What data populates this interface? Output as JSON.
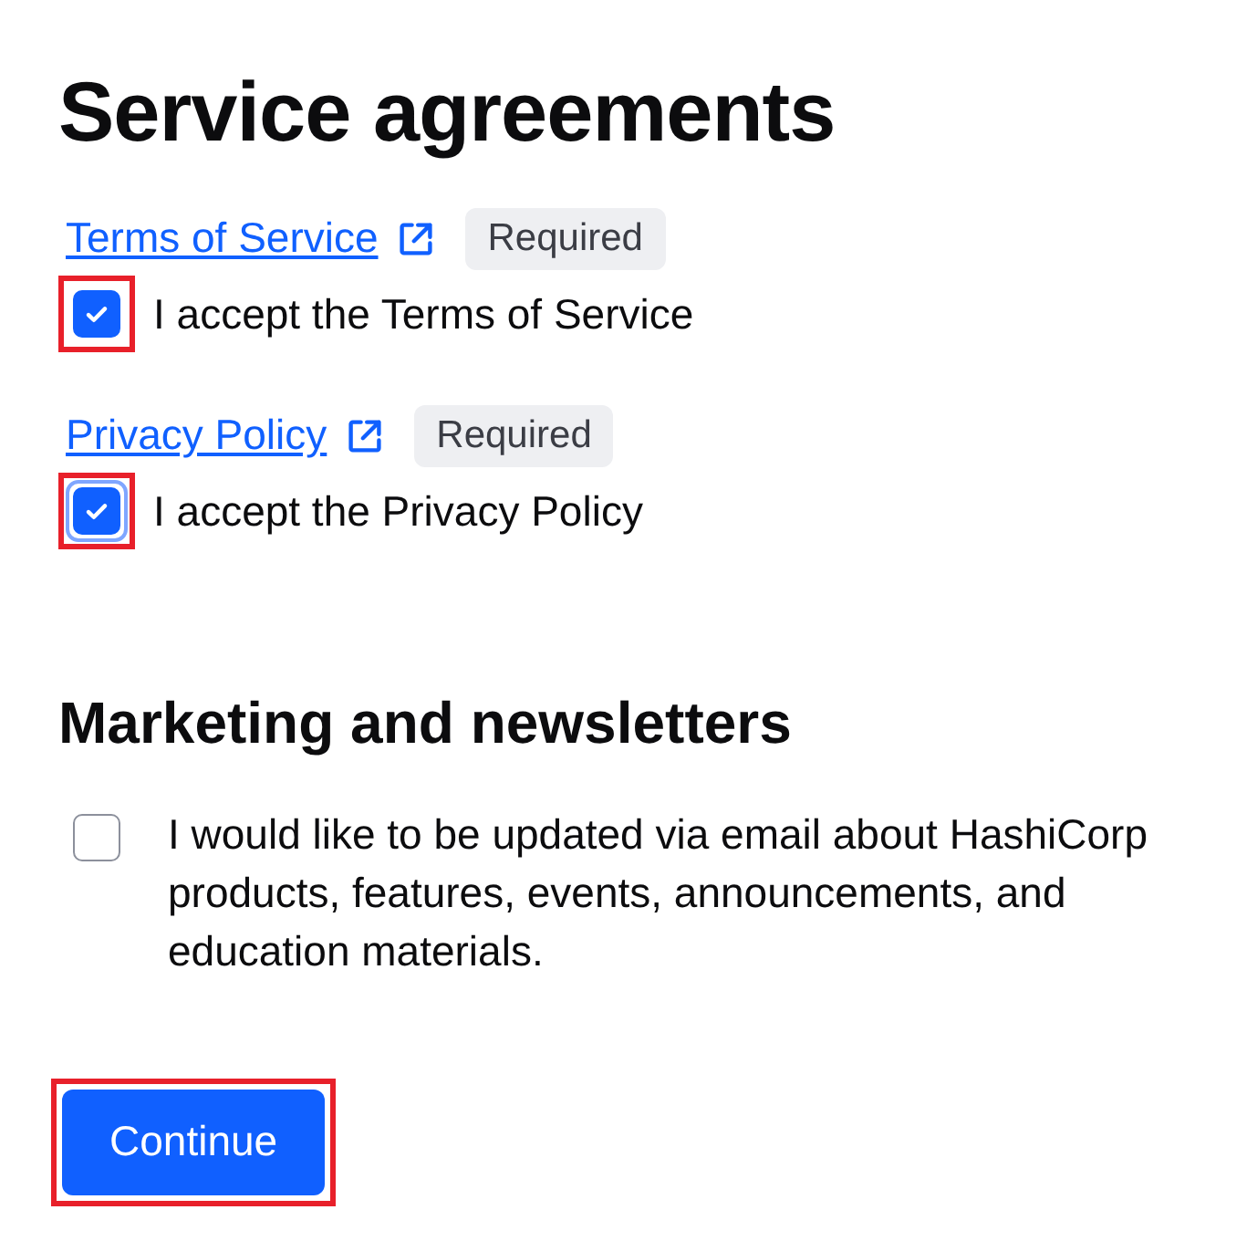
{
  "title": "Service agreements",
  "agreements": [
    {
      "link": "Terms of Service",
      "badge": "Required",
      "checkbox": {
        "label": "I accept the Terms of Service",
        "checked": true,
        "focused": false,
        "highlighted": true
      }
    },
    {
      "link": "Privacy Policy",
      "badge": "Required",
      "checkbox": {
        "label": "I accept the Privacy Policy",
        "checked": true,
        "focused": true,
        "highlighted": true
      }
    }
  ],
  "marketing": {
    "title": "Marketing and newsletters",
    "checkbox": {
      "label": "I would like to be updated via email about HashiCorp products, features, events, announcements, and education materials.",
      "checked": false,
      "focused": false,
      "highlighted": false
    }
  },
  "button": {
    "label": "Continue",
    "highlighted": true
  }
}
